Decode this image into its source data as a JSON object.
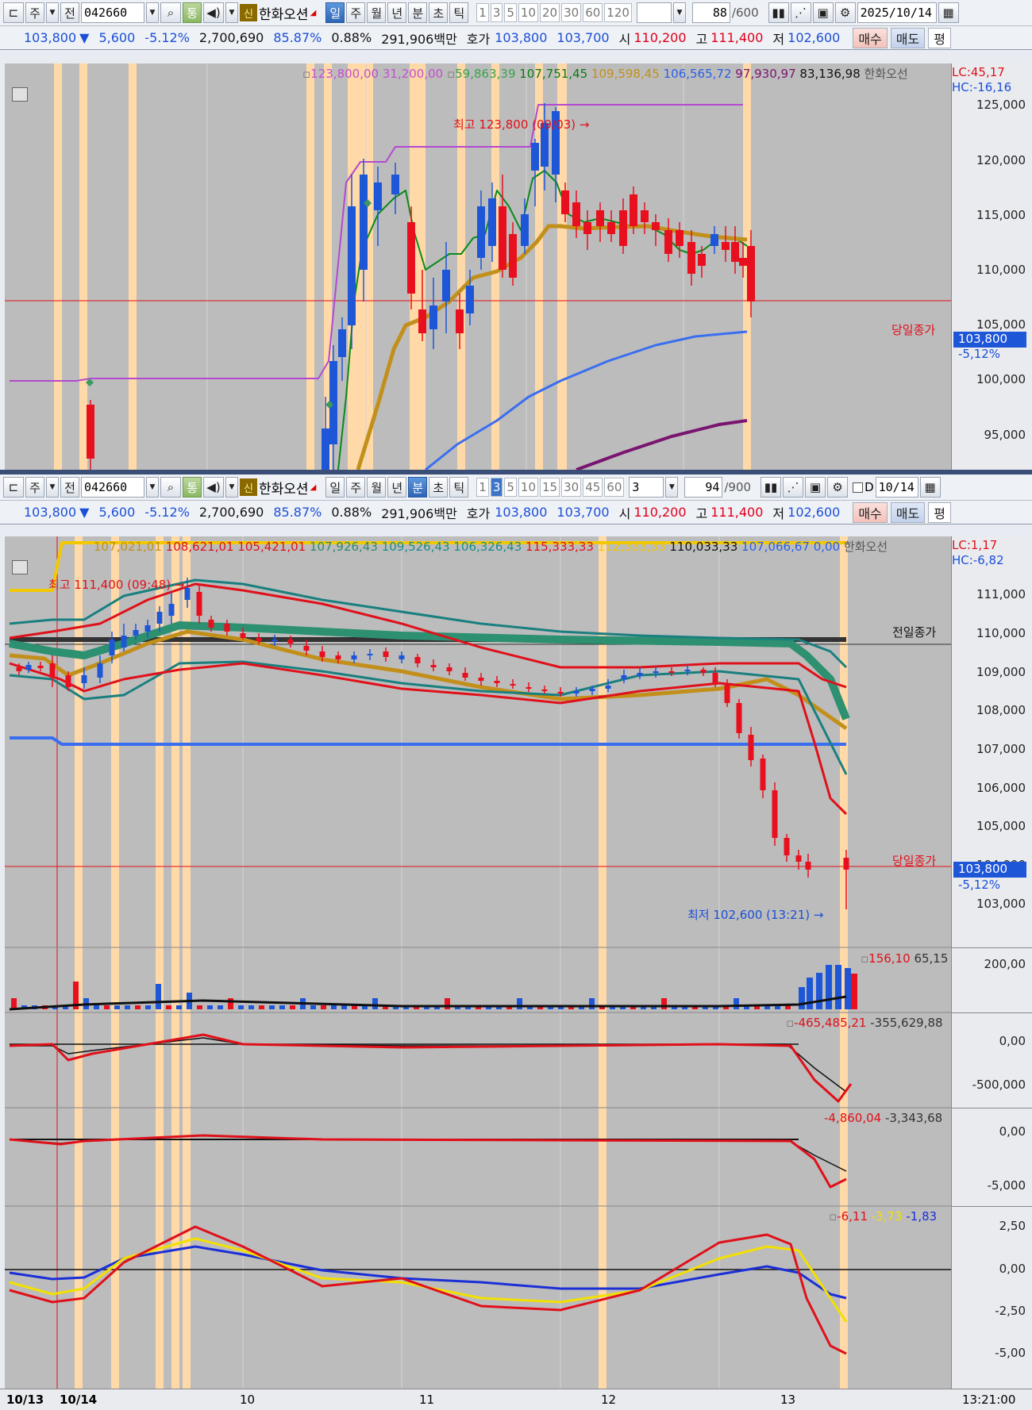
{
  "top_toolbar": {
    "type_label": "주",
    "mode_label": "전",
    "code": "042660",
    "tong": "통",
    "sin": "신",
    "name": "한화오션",
    "periods": [
      "일",
      "주",
      "월",
      "년",
      "분",
      "초",
      "틱"
    ],
    "nums": [
      "1",
      "3",
      "5",
      "10",
      "20",
      "30",
      "60",
      "120"
    ],
    "count": "88",
    "count_max": "/600",
    "date": "2025/10/14"
  },
  "top_info": {
    "price": "103,800",
    "arrow": "▼",
    "change": "5,600",
    "rate": "-5.12%",
    "volume": "2,700,690",
    "turnover": "85.87%",
    "ratio": "0.88%",
    "amount": "291,906백만",
    "quote_label": "호가",
    "ask": "103,800",
    "bid": "103,700",
    "open_label": "시",
    "open": "110,200",
    "high_label": "고",
    "high": "111,400",
    "low_label": "저",
    "low": "102,600",
    "buy": "매수",
    "sell": "매도",
    "extra": "평"
  },
  "top_chart": {
    "legend": [
      "123,800,00",
      "31,200,00",
      "59,863,39",
      "107,751,45",
      "109,598,45",
      "106,565,72",
      "97,930,97",
      "83,136,98"
    ],
    "legend_name": "한화오선",
    "lc": "LC:45,17",
    "hc": "HC:-16,16",
    "high_note": "최고 123,800 (09/03) →",
    "close_label": "당일종가",
    "price_tag": "103,800",
    "price_pct": "-5,12%",
    "axis": [
      "125,000",
      "120,000",
      "115,000",
      "110,000",
      "105,000",
      "100,000",
      "95,000"
    ]
  },
  "mid_toolbar": {
    "type_label": "주",
    "mode_label": "전",
    "code": "042660",
    "tong": "통",
    "sin": "신",
    "name": "한화오션",
    "periods": [
      "일",
      "주",
      "월",
      "년",
      "분",
      "초",
      "틱"
    ],
    "nums": [
      "1",
      "3",
      "5",
      "10",
      "15",
      "30",
      "45",
      "60"
    ],
    "interval": "3",
    "count": "94",
    "count_max": "/900",
    "date": "10/14",
    "d_label": "D"
  },
  "mid_info": {
    "price": "103,800",
    "arrow": "▼",
    "change": "5,600",
    "rate": "-5.12%",
    "volume": "2,700,690",
    "turnover": "85.87%",
    "ratio": "0.88%",
    "amount": "291,906백만",
    "quote_label": "호가",
    "ask": "103,800",
    "bid": "103,700",
    "open_label": "시",
    "open": "110,200",
    "high_label": "고",
    "high": "111,400",
    "low_label": "저",
    "low": "102,600",
    "buy": "매수",
    "sell": "매도",
    "extra": "평"
  },
  "main_chart": {
    "legend": [
      "107,021,01",
      "108,621,01",
      "105,421,01",
      "107,926,43",
      "109,526,43",
      "106,326,43",
      "115,333,33",
      "112,333,33",
      "110,033,33",
      "107,066,67",
      "0,00"
    ],
    "legend_name": "한화오선",
    "lc": "LC:1,17",
    "hc": "HC:-6,82",
    "high_note": "최고 111,400 (09:48) →",
    "low_note": "최저 102,600 (13:21) →",
    "prev_close_label": "전일종가",
    "close_label": "당일종가",
    "price_tag": "103,800",
    "price_pct": "-5,12%",
    "axis": [
      "111,000",
      "110,000",
      "109,000",
      "108,000",
      "107,000",
      "106,000",
      "105,000",
      "104,000",
      "103,000"
    ]
  },
  "vol_panel": {
    "v1": "156,10",
    "v2": "65,15",
    "axis": [
      "200,00"
    ]
  },
  "p2_panel": {
    "v1": "-465,485,21",
    "v2": "-355,629,88",
    "axis": [
      "0,00",
      "-500,000"
    ]
  },
  "p3_panel": {
    "v1": "-4,860,04",
    "v2": "-3,343,68",
    "axis": [
      "0,00",
      "-5,000"
    ]
  },
  "p4_panel": {
    "v1": "-6,11",
    "v2": "-3,73",
    "v3": "-1,83",
    "axis": [
      "2,50",
      "0,00",
      "-2,50",
      "-5,00"
    ]
  },
  "time_axis": {
    "labels": [
      "10/13",
      "10/14",
      "10",
      "11",
      "12",
      "13"
    ],
    "end": "13:21:00"
  },
  "colors": {
    "up": "#e8101e",
    "down": "#1e56d8",
    "highlight": "#ffd9a8",
    "bg": "#bcbcbc"
  }
}
